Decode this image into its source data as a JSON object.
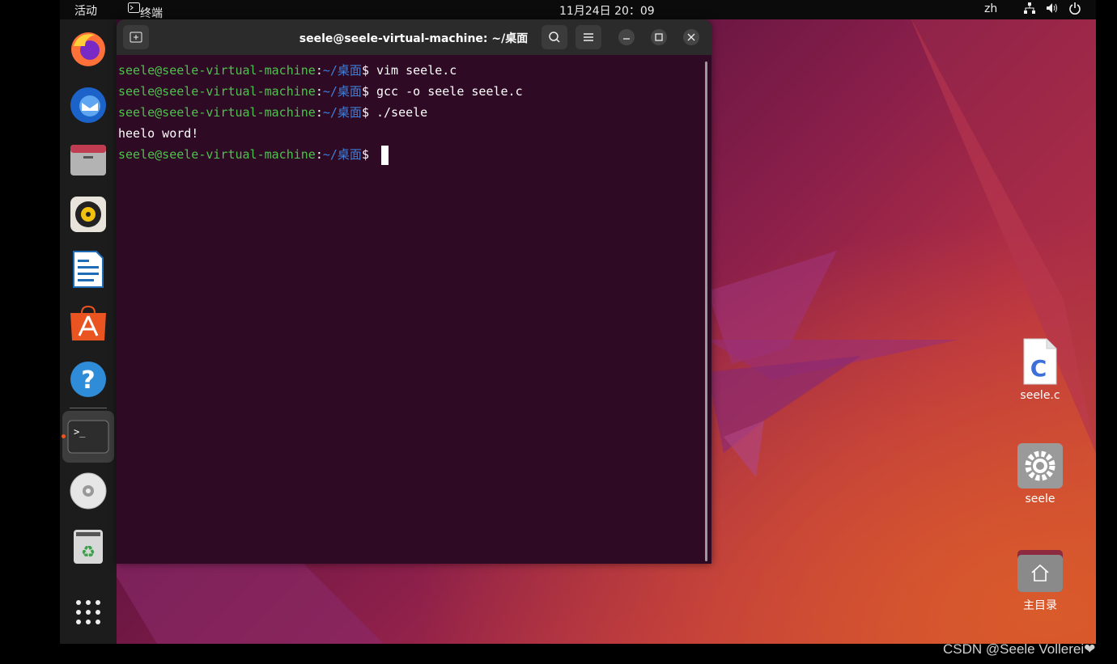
{
  "topbar": {
    "activities": "活动",
    "app_name": "终端",
    "clock": "11月24日  20：09",
    "input_method": "zh"
  },
  "dock": {
    "items": [
      {
        "icon": "firefox-icon"
      },
      {
        "icon": "thunderbird-icon"
      },
      {
        "icon": "files-icon"
      },
      {
        "icon": "rhythmbox-icon"
      },
      {
        "icon": "libreoffice-writer-icon"
      },
      {
        "icon": "app-center-icon"
      },
      {
        "icon": "help-icon"
      },
      {
        "icon": "terminal-icon",
        "active": true
      },
      {
        "icon": "disc-icon"
      },
      {
        "icon": "trash-icon"
      },
      {
        "icon": "show-apps-icon"
      }
    ]
  },
  "terminal": {
    "title": "seele@seele-virtual-machine: ~/桌面",
    "lines": [
      {
        "user": "seele@seele-virtual-machine",
        "sep": ":",
        "path": "~/桌面",
        "prompt": "$ ",
        "cmd": "vim seele.c"
      },
      {
        "user": "seele@seele-virtual-machine",
        "sep": ":",
        "path": "~/桌面",
        "prompt": "$ ",
        "cmd": "gcc -o seele seele.c"
      },
      {
        "user": "seele@seele-virtual-machine",
        "sep": ":",
        "path": "~/桌面",
        "prompt": "$ ",
        "cmd": "./seele"
      },
      {
        "output": "heelo word!"
      },
      {
        "user": "seele@seele-virtual-machine",
        "sep": ":",
        "path": "~/桌面",
        "prompt": "$ ",
        "cmd": ""
      }
    ]
  },
  "desktop": {
    "icons": [
      {
        "label": "seele.c",
        "icon": "c-source-file-icon"
      },
      {
        "label": "seele",
        "icon": "executable-gear-icon"
      },
      {
        "label": "主目录",
        "icon": "home-folder-icon"
      }
    ]
  },
  "watermark": "CSDN @Seele Vollerei❤"
}
